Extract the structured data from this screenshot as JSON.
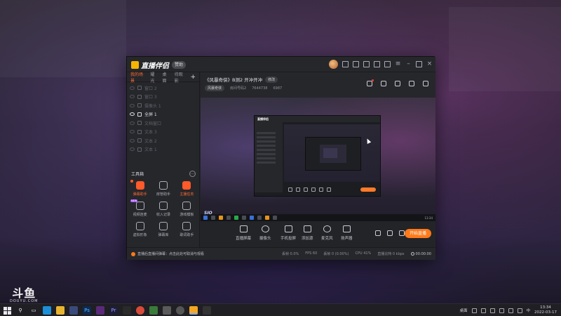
{
  "app": {
    "name": "直播伴侣",
    "version_button": "赞助"
  },
  "left_panel": {
    "tabs": [
      "我的场景",
      "耀光",
      "桌面",
      "待观影"
    ],
    "active_tab": 0,
    "scenes": [
      {
        "label": "窗口 2",
        "on": false
      },
      {
        "label": "窗口 3",
        "on": false
      },
      {
        "label": "摄像头 1",
        "on": false
      },
      {
        "label": "全屏 1",
        "on": true
      },
      {
        "label": "文档窗口",
        "on": false
      },
      {
        "label": "文本 3",
        "on": false
      },
      {
        "label": "文本 2",
        "on": false
      },
      {
        "label": "文本 1",
        "on": false
      }
    ],
    "toolbox_title": "工具箱",
    "tools": [
      {
        "label": "弹幕助手",
        "icon": "danmaku-icon",
        "hot": true,
        "dot": true
      },
      {
        "label": "房管助手",
        "icon": "admin-icon",
        "hot": false
      },
      {
        "label": "主播任务",
        "icon": "task-icon",
        "hot": true
      },
      {
        "label": "视频连麦",
        "icon": "video-link-icon",
        "hot": false,
        "new": "NEW"
      },
      {
        "label": "收入记录",
        "icon": "income-icon",
        "hot": false
      },
      {
        "label": "游戏模板",
        "icon": "template-icon",
        "hot": false
      },
      {
        "label": "虚拟形象",
        "icon": "avatar-icon",
        "hot": false
      },
      {
        "label": "弹幕库",
        "icon": "danmaku-lib-icon",
        "hot": false
      },
      {
        "label": "歌词助手",
        "icon": "lyrics-icon",
        "hot": false
      }
    ]
  },
  "stream": {
    "title": "《风暴奇侠》B测2 开冲开冲",
    "modify_button": "修改",
    "category": "风暴奇侠",
    "room": "房间号码2",
    "room_number": "7644738",
    "popularity": "6987"
  },
  "preview": {
    "nested_logo": "直播伴侣",
    "stamp": "SIO"
  },
  "controls": {
    "items": [
      {
        "label": "直播屏幕",
        "icon": "screen-share-icon"
      },
      {
        "label": "摄像头",
        "icon": "camera-icon"
      },
      {
        "label": "手机投屏",
        "icon": "phone-cast-icon"
      },
      {
        "label": "添加源",
        "icon": "add-source-icon"
      },
      {
        "label": "麦克风",
        "icon": "microphone-icon"
      },
      {
        "label": "扬声器",
        "icon": "speaker-icon"
      }
    ],
    "go_live": "开始直播"
  },
  "status": {
    "notice": "直播后直播间弹幕：点击此处可取消与观看",
    "stats": [
      "丢帧 0.0%",
      "FPS 60",
      "丢帧 0 (0.00%)",
      "CPU 41%",
      "直播比特 0 kbps"
    ],
    "record_time": "00:00:00"
  },
  "watermark": {
    "brand": "斗鱼",
    "domain": "DOUYU.COM"
  },
  "taskbar": {
    "tray_text": "桌面",
    "ime": "中",
    "time": "13:34",
    "date": "2022-03-17"
  }
}
